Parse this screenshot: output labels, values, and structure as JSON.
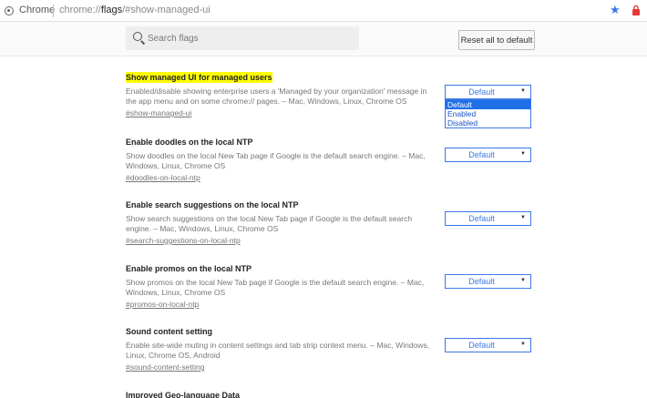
{
  "omnibox": {
    "site_name": "Chrome",
    "url_prefix": "chrome://",
    "url_host": "flags",
    "url_path": "/#show-managed-ui"
  },
  "header": {
    "search_placeholder": "Search flags",
    "reset_label": "Reset all to default"
  },
  "experiments": [
    {
      "title": "Show managed UI for managed users",
      "description": "Enabled/disable showing enterprise users a 'Managed by your organization' message in the app menu and on some chrome:// pages. – Mac, Windows, Linux, Chrome OS",
      "link": "#show-managed-ui",
      "value": "Default"
    },
    {
      "title": "Enable doodles on the local NTP",
      "description": "Show doodles on the local New Tab page if Google is the default search engine. – Mac, Windows, Linux, Chrome OS",
      "link": "#doodles-on-local-ntp",
      "value": "Default"
    },
    {
      "title": "Enable search suggestions on the local NTP",
      "description": "Show search suggestions on the local New Tab page if Google is the default search engine. – Mac, Windows, Linux, Chrome OS",
      "link": "#search-suggestions-on-local-ntp",
      "value": "Default"
    },
    {
      "title": "Enable promos on the local NTP",
      "description": "Show promos on the local New Tab page if Google is the default search engine. – Mac, Windows, Linux, Chrome OS",
      "link": "#promos-on-local-ntp",
      "value": "Default"
    },
    {
      "title": "Sound content setting",
      "description": "Enable site-wide muting in content settings and tab strip context menu. – Mac, Windows, Linux, Chrome OS, Android",
      "link": "#sound-content-setting",
      "value": "Default"
    },
    {
      "title": "Improved Geo-language Data"
    }
  ],
  "dropdown": {
    "options": [
      "Default",
      "Enabled",
      "Disabled"
    ],
    "selected": "Default"
  },
  "colors": {
    "highlight": "#ffff00",
    "accent": "#3b78e7",
    "selected_option": "#1e6fe8"
  }
}
